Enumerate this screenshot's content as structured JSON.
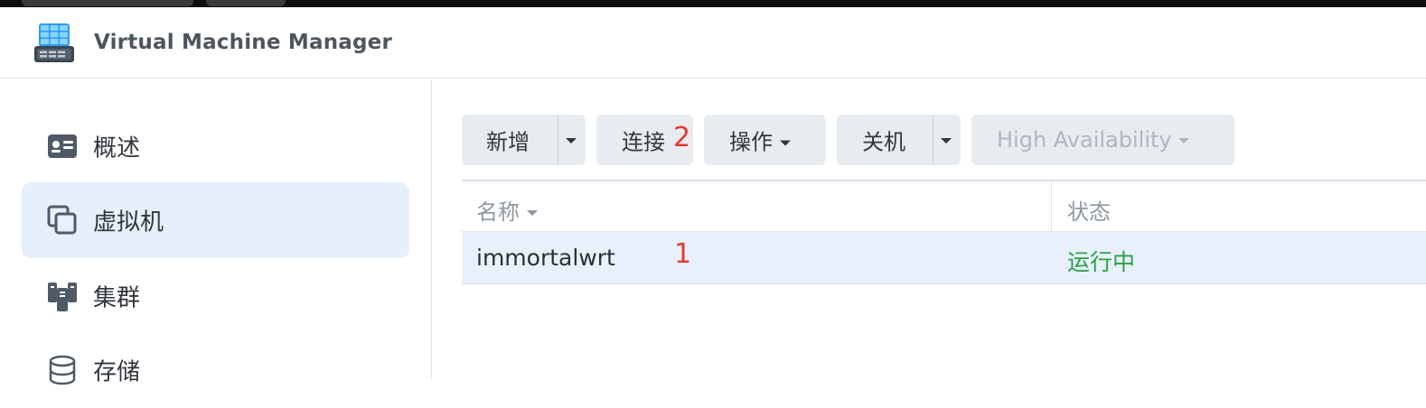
{
  "app": {
    "title": "Virtual Machine Manager",
    "icon": "vmm-app-icon"
  },
  "sidebar": {
    "items": [
      {
        "label": "概述",
        "icon": "overview-card-icon",
        "active": false
      },
      {
        "label": "虚拟机",
        "icon": "virtual-machine-icon",
        "active": true
      },
      {
        "label": "集群",
        "icon": "cluster-icon",
        "active": false
      },
      {
        "label": "存储",
        "icon": "storage-icon",
        "active": false
      }
    ]
  },
  "toolbar": {
    "create_label": "新增",
    "connect_label": "连接",
    "action_label": "操作",
    "shutdown_label": "关机",
    "ha_label": "High Availability"
  },
  "table": {
    "headers": {
      "name": "名称",
      "status": "状态"
    },
    "rows": [
      {
        "name": "immortalwrt",
        "status": "运行中"
      }
    ]
  },
  "annotations": {
    "row_marker": "1",
    "connect_marker": "2"
  },
  "colors": {
    "accent_selected": "#e6f0fb",
    "status_running": "#2ea043",
    "annotation_red": "#e53935",
    "button_bg": "#e8ecf1"
  }
}
